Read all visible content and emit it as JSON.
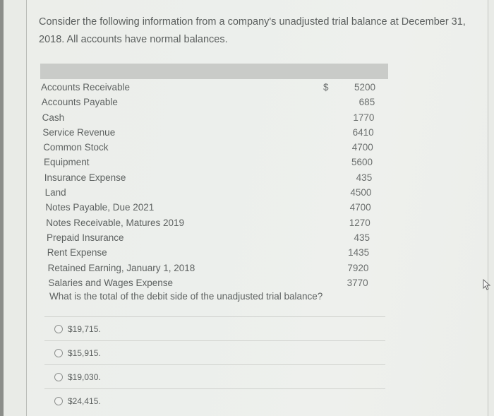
{
  "question": {
    "prompt": "Consider the following information from a company's unadjusted trial balance at December 31, 2018. All accounts have normal balances.",
    "currency_symbol": "$",
    "accounts": [
      {
        "name": "Accounts Receivable",
        "amount": "5200"
      },
      {
        "name": "Accounts Payable",
        "amount": "685"
      },
      {
        "name": "Cash",
        "amount": "1770"
      },
      {
        "name": "Service Revenue",
        "amount": "6410"
      },
      {
        "name": "Common Stock",
        "amount": "4700"
      },
      {
        "name": "Equipment",
        "amount": "5600"
      },
      {
        "name": "Insurance Expense",
        "amount": "435"
      },
      {
        "name": "Land",
        "amount": "4500"
      },
      {
        "name": "Notes Payable, Due 2021",
        "amount": "4700"
      },
      {
        "name": "Notes Receivable, Matures 2019",
        "amount": "1270"
      },
      {
        "name": "Prepaid Insurance",
        "amount": "435"
      },
      {
        "name": "Rent Expense",
        "amount": "1435"
      },
      {
        "name": "Retained Earning, January 1, 2018",
        "amount": "7920"
      },
      {
        "name": "Salaries and Wages Expense",
        "amount": "3770"
      }
    ],
    "text": "What is the total of the debit side of the unadjusted trial balance?"
  },
  "options": [
    {
      "label": "$19,715.",
      "selected": false
    },
    {
      "label": "$15,915.",
      "selected": false
    },
    {
      "label": "$19,030.",
      "selected": false
    },
    {
      "label": "$24,415.",
      "selected": false
    }
  ]
}
